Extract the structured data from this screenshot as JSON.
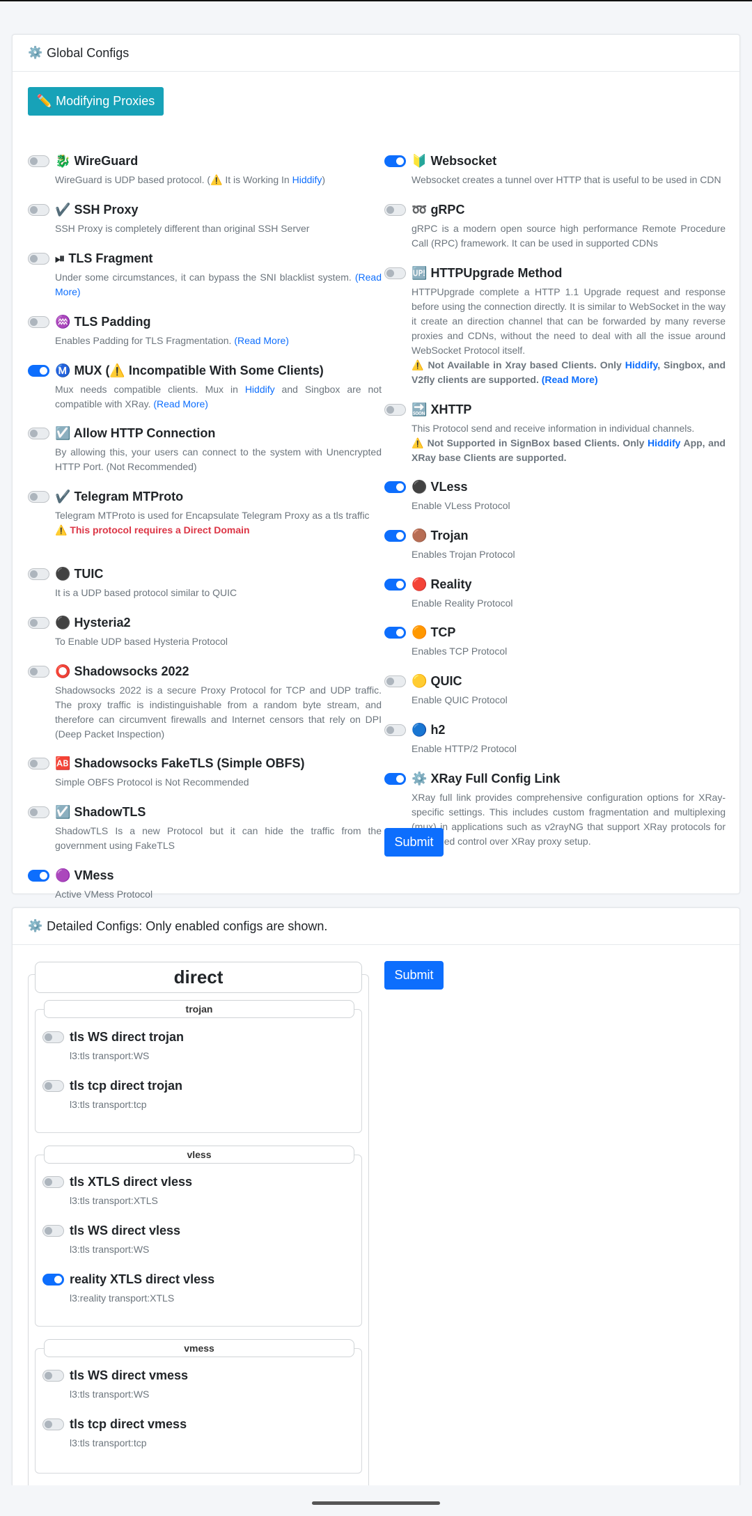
{
  "global": {
    "header_icon": "⚙️",
    "header_title": "Global Configs",
    "modify_button": "✏️ Modifying Proxies",
    "submit_label": "Submit",
    "left": [
      {
        "icon": "🐉",
        "title": "WireGuard",
        "on": false,
        "desc_pre": "WireGuard is UDP based protocol. (⚠️ It is Working In ",
        "link": "Hiddify",
        "desc_post": ")"
      },
      {
        "icon": "✔️",
        "title": "SSH Proxy",
        "on": false,
        "desc": "SSH Proxy is completely different than original SSH Server"
      },
      {
        "icon": "⏯",
        "title": "TLS Fragment",
        "on": false,
        "desc": "Under some circumstances, it can bypass the SNI blacklist system.",
        "more": "(Read More)"
      },
      {
        "icon": "♒",
        "title": "TLS Padding",
        "on": false,
        "desc": "Enables Padding for TLS Fragmentation.",
        "more": "(Read More)"
      },
      {
        "icon": "Ⓜ️",
        "title": "MUX (⚠️ Incompatible With Some Clients)",
        "on": true,
        "desc_pre": "Mux needs compatible clients. Mux in ",
        "link": "Hiddify",
        "desc_post": " and Singbox are not compatible with XRay.",
        "more": "(Read More)"
      },
      {
        "icon": "☑️",
        "title": "Allow HTTP Connection",
        "on": false,
        "desc": "By allowing this, your users can connect to the system with Unencrypted HTTP Port. (Not Recommended)"
      },
      {
        "icon": "✔️",
        "title": "Telegram MTProto",
        "on": false,
        "desc": "Telegram MTProto is used for Encapsulate Telegram Proxy as a tls traffic",
        "warning": "⚠️ This protocol requires a Direct Domain"
      },
      {
        "icon": "⚫",
        "title": "TUIC",
        "on": false,
        "desc": "It is a UDP based protocol similar to QUIC"
      },
      {
        "icon": "⚫",
        "title": "Hysteria2",
        "on": false,
        "desc": "To Enable UDP based Hysteria Protocol"
      },
      {
        "icon": "⭕",
        "title": "Shadowsocks 2022",
        "on": false,
        "desc": "Shadowsocks 2022 is a secure Proxy Protocol for TCP and UDP traffic. The proxy traffic is indistinguishable from a random byte stream, and therefore can circumvent firewalls and Internet censors that rely on DPI (Deep Packet Inspection)"
      },
      {
        "icon": "🆎",
        "title": "Shadowsocks FakeTLS (Simple OBFS)",
        "on": false,
        "desc": "Simple OBFS Protocol is Not Recommended"
      },
      {
        "icon": "☑️",
        "title": "ShadowTLS",
        "on": false,
        "desc": "ShadowTLS Is a new Protocol but it can hide the traffic from the government using FakeTLS"
      },
      {
        "icon": "🟣",
        "title": "VMess",
        "on": true,
        "desc": "Active VMess Protocol"
      }
    ],
    "right": [
      {
        "icon": "🔰",
        "title": "Websocket",
        "on": true,
        "desc": "Websocket creates a tunnel over HTTP that is useful to be used in CDN"
      },
      {
        "icon": "➿",
        "title": "gRPC",
        "on": false,
        "desc": "gRPC is a modern open source high performance Remote Procedure Call (RPC) framework. It can be used in supported CDNs"
      },
      {
        "icon": "🆙",
        "title": "HTTPUpgrade Method",
        "on": false,
        "desc": "HTTPUpgrade complete a HTTP 1.1 Upgrade request and response before using the connection directly. It is similar to WebSocket in the way it create an direction channel that can be forwarded by many reverse proxies and CDNs, without the need to deal with all the issue around WebSocket Protocol itself.",
        "warn_pre": "⚠️ Not Available in Xray based Clients. Only ",
        "warn_link": "Hiddify",
        "warn_post": ", Singbox, and V2fly clients are supported.",
        "warn_more": "(Read More)"
      },
      {
        "icon": "🔜",
        "title": "XHTTP",
        "on": false,
        "desc": "This Protocol send and receive information in individual channels.",
        "warn_pre": "⚠️ Not Supported in SignBox based Clients. Only ",
        "warn_link": "Hiddify",
        "warn_post": " App, and XRay base Clients are supported."
      },
      {
        "icon": "⚫",
        "title": "VLess",
        "on": true,
        "desc": "Enable VLess Protocol"
      },
      {
        "icon": "🟤",
        "title": "Trojan",
        "on": true,
        "desc": "Enables Trojan Protocol"
      },
      {
        "icon": "🔴",
        "title": "Reality",
        "on": true,
        "desc": "Enable Reality Protocol"
      },
      {
        "icon": "🟠",
        "title": "TCP",
        "on": true,
        "desc": "Enables TCP Protocol"
      },
      {
        "icon": "🟡",
        "title": "QUIC",
        "on": false,
        "desc": "Enable QUIC Protocol"
      },
      {
        "icon": "🔵",
        "title": "h2",
        "on": false,
        "desc": "Enable HTTP/2 Protocol"
      },
      {
        "icon": "⚙️",
        "title": "XRay Full Config Link",
        "on": true,
        "desc": "XRay full link provides comprehensive configuration options for XRay-specific settings. This includes custom fragmentation and multiplexing (mux) in applications such as v2rayNG that support XRay protocols for fine-tuned control over XRay proxy setup."
      }
    ]
  },
  "detailed": {
    "header_icon": "⚙️",
    "header_title": "Detailed Configs: Only enabled configs are shown.",
    "submit_label": "Submit",
    "section_title": "direct",
    "groups": [
      {
        "name": "trojan",
        "items": [
          {
            "title": "tls WS direct trojan",
            "desc": "l3:tls transport:WS",
            "on": false
          },
          {
            "title": "tls tcp direct trojan",
            "desc": "l3:tls transport:tcp",
            "on": false
          }
        ]
      },
      {
        "name": "vless",
        "items": [
          {
            "title": "tls XTLS direct vless",
            "desc": "l3:tls transport:XTLS",
            "on": false
          },
          {
            "title": "tls WS direct vless",
            "desc": "l3:tls transport:WS",
            "on": false
          },
          {
            "title": "reality XTLS direct vless",
            "desc": "l3:reality transport:XTLS",
            "on": true
          }
        ]
      },
      {
        "name": "vmess",
        "items": [
          {
            "title": "tls WS direct vmess",
            "desc": "l3:tls transport:WS",
            "on": false
          },
          {
            "title": "tls tcp direct vmess",
            "desc": "l3:tls transport:tcp",
            "on": false
          }
        ]
      }
    ]
  }
}
